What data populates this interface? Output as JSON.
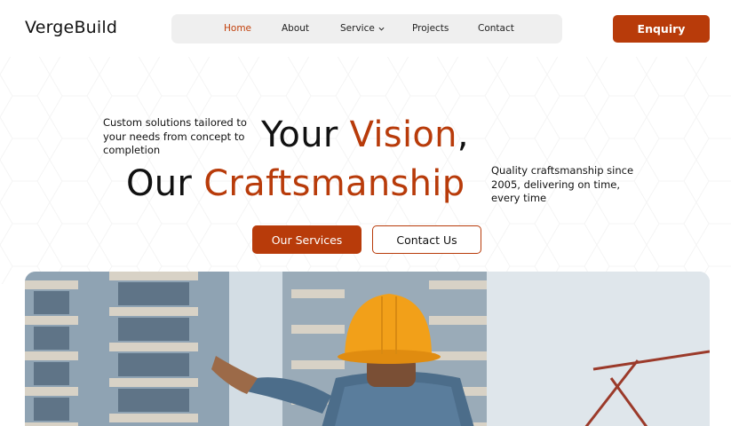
{
  "brand": {
    "name": "VergeBuild"
  },
  "nav": {
    "items": [
      {
        "label": "Home",
        "active": true
      },
      {
        "label": "About",
        "active": false
      },
      {
        "label": "Service",
        "active": false,
        "has_dropdown": true
      },
      {
        "label": "Projects",
        "active": false
      },
      {
        "label": "Contact",
        "active": false
      }
    ],
    "enquiry_label": "Enquiry"
  },
  "hero": {
    "side_left": "Custom solutions tailored to your needs from concept to completion",
    "side_right": "Quality craftsmanship since 2005, delivering on time, every time",
    "line1_plain": "Your ",
    "line1_accent": "Vision",
    "line1_suffix": ",",
    "line2_plain": "Our ",
    "line2_accent": "Craftsmanship",
    "primary_button": "Our Services",
    "secondary_button": "Contact Us"
  },
  "colors": {
    "accent": "#b83b0a",
    "nav_bg": "#efefef",
    "hardhat": "#f2a019"
  },
  "icons": {
    "dropdown": "chevron-down-icon"
  }
}
